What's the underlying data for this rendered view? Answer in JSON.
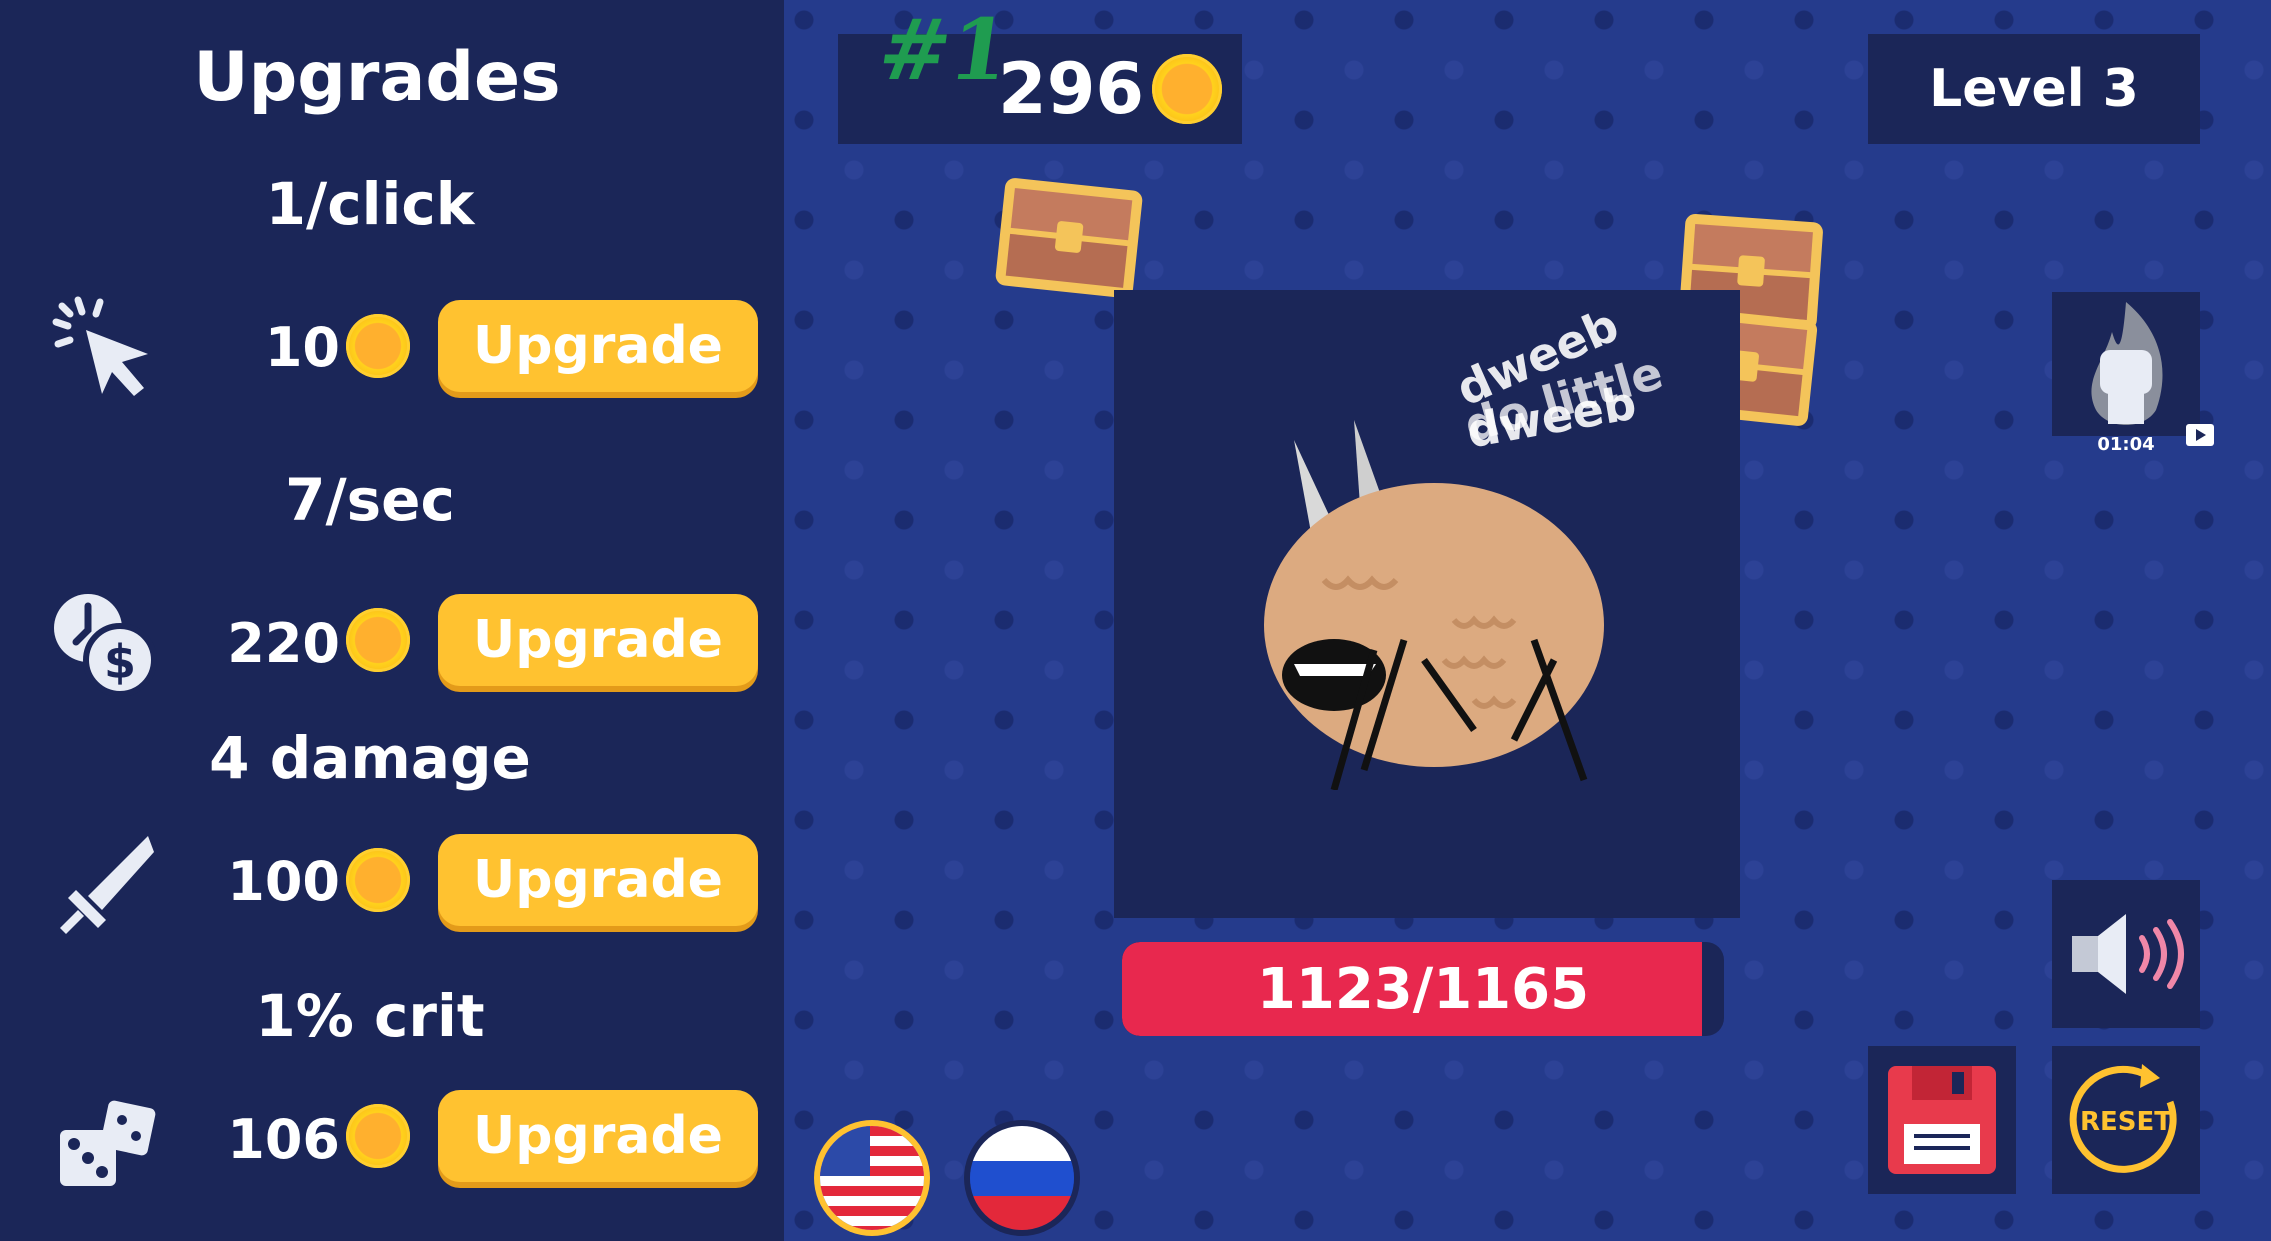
{
  "sidebar": {
    "title": "Upgrades",
    "upgrades": [
      {
        "stat": "1/click",
        "cost": "10",
        "button": "Upgrade",
        "icon": "click-icon"
      },
      {
        "stat": "7/sec",
        "cost": "220",
        "button": "Upgrade",
        "icon": "clock-money-icon"
      },
      {
        "stat": "4 damage",
        "cost": "100",
        "button": "Upgrade",
        "icon": "sword-icon"
      },
      {
        "stat": "1% crit",
        "cost": "106",
        "button": "Upgrade",
        "icon": "dice-icon"
      }
    ]
  },
  "top": {
    "rank": "#1",
    "coins": "296",
    "level": "Level 3"
  },
  "enemy": {
    "hp_text": "1123/1165",
    "hp_fraction": 0.964,
    "floating_texts": [
      "dweeb",
      "do little",
      "dweeb"
    ]
  },
  "boost": {
    "timer": "01:04",
    "icon": "fist-fire-icon"
  },
  "buttons": {
    "reset_label": "RESET"
  },
  "languages": [
    "en",
    "ru"
  ],
  "colors": {
    "accent": "#ffc230",
    "panel": "#1b2658",
    "hp": "#e8284e",
    "background": "#253b8c"
  }
}
